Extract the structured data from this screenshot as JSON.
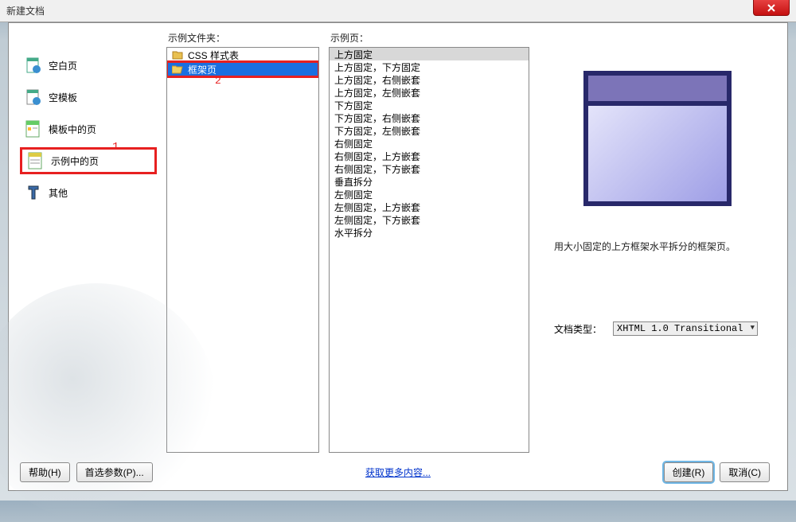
{
  "window": {
    "title": "新建文档"
  },
  "sidebar": {
    "items": [
      {
        "label": "空白页"
      },
      {
        "label": "空模板"
      },
      {
        "label": "模板中的页"
      },
      {
        "label": "示例中的页"
      },
      {
        "label": "其他"
      }
    ]
  },
  "annotations": {
    "one": "1",
    "two": "2"
  },
  "folder_col": {
    "label": "示例文件夹：",
    "items": [
      {
        "label": "CSS 样式表"
      },
      {
        "label": "框架页"
      }
    ]
  },
  "page_col": {
    "label": "示例页：",
    "items": [
      "上方固定",
      "上方固定，下方固定",
      "上方固定，右侧嵌套",
      "上方固定，左侧嵌套",
      "下方固定",
      "下方固定，右侧嵌套",
      "下方固定，左侧嵌套",
      "右侧固定",
      "右侧固定，上方嵌套",
      "右侧固定，下方嵌套",
      "垂直拆分",
      "左侧固定",
      "左侧固定，上方嵌套",
      "左侧固定，下方嵌套",
      "水平拆分"
    ],
    "selected_index": 0
  },
  "preview": {
    "description": "用大小固定的上方框架水平拆分的框架页。",
    "doctype_label": "文档类型：",
    "doctype_value": "XHTML 1.0 Transitional"
  },
  "buttons": {
    "help": "帮助(H)",
    "prefs": "首选参数(P)...",
    "more_link": "获取更多内容...",
    "create": "创建(R)",
    "cancel": "取消(C)"
  }
}
